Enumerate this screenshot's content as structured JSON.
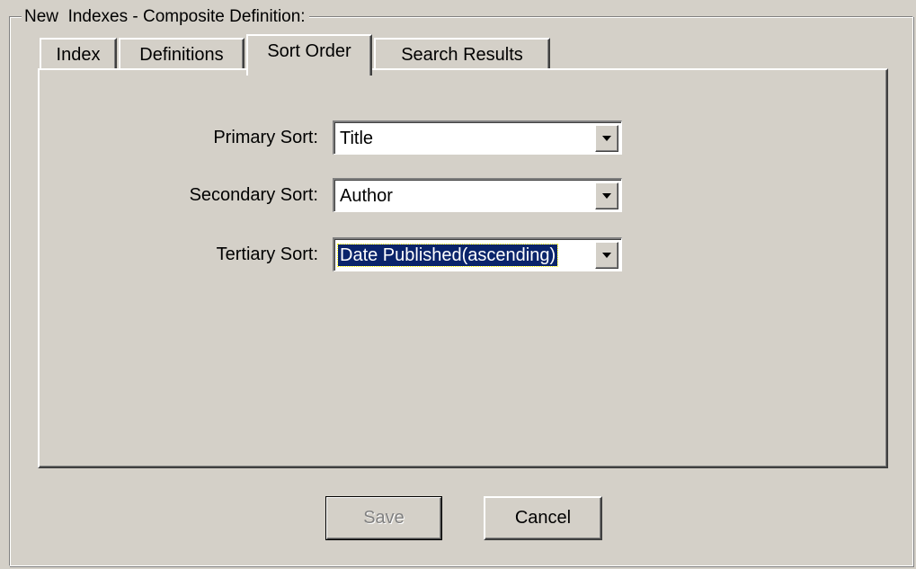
{
  "group": {
    "legend": "New  Indexes - Composite Definition:"
  },
  "tabs": [
    {
      "label": "Index",
      "active": false
    },
    {
      "label": "Definitions",
      "active": false
    },
    {
      "label": "Sort Order",
      "active": true
    },
    {
      "label": "Search Results",
      "active": false
    }
  ],
  "sort": {
    "primary_label": "Primary Sort:",
    "primary_value": "Title",
    "secondary_label": "Secondary Sort:",
    "secondary_value": "Author",
    "tertiary_label": "Tertiary Sort:",
    "tertiary_value": "Date Published(ascending)"
  },
  "buttons": {
    "save_label": "Save",
    "save_enabled": false,
    "cancel_label": "Cancel"
  },
  "icons": {
    "dropdown": "chevron-down-icon"
  },
  "colors": {
    "face": "#d4d0c8",
    "selection": "#0a246a",
    "disabled_text": "#808080"
  }
}
